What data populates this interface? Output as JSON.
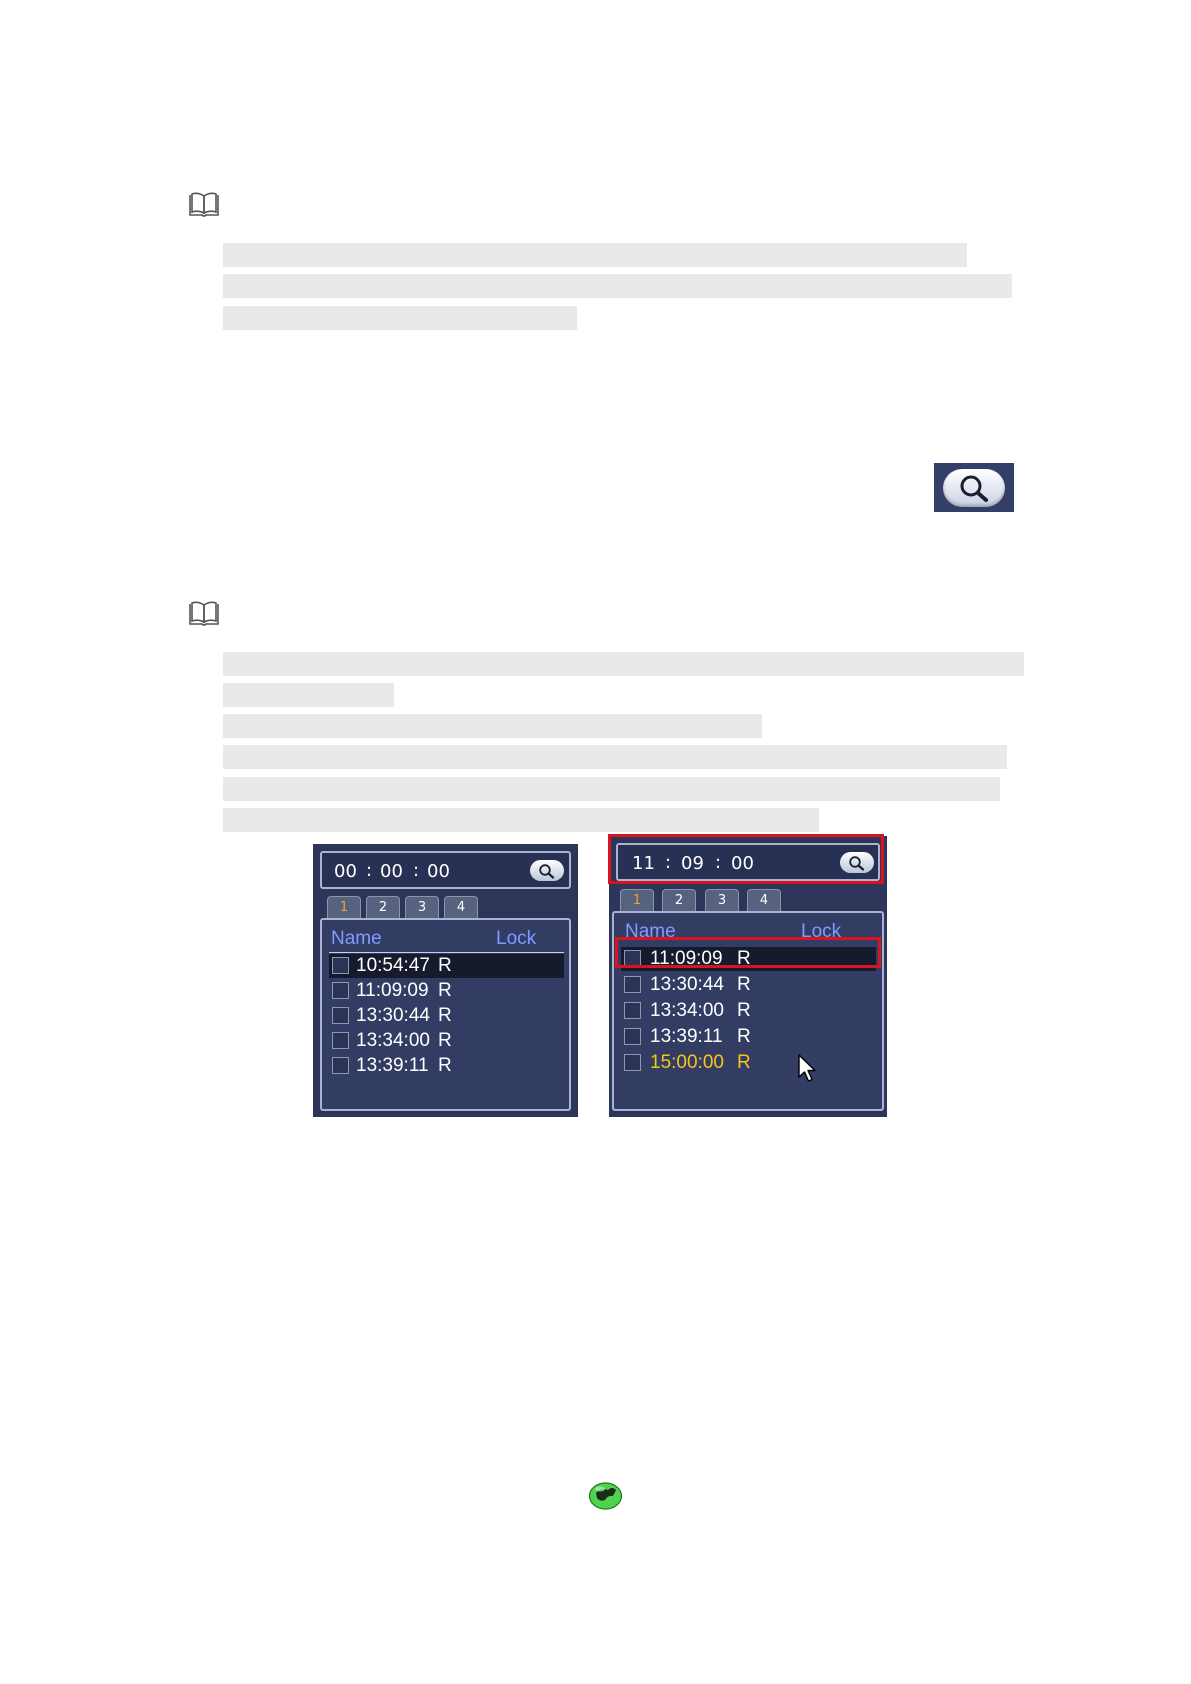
{
  "icons": {
    "note_icon": "book-icon",
    "search_icon": "magnifier-icon",
    "cursor_icon": "mouse-pointer-icon",
    "globe_icon": "green-globe-icon"
  },
  "panel_left": {
    "time": {
      "hh": "00",
      "sep1": ":",
      "mm": "00",
      "sep2": ":",
      "ss": "00"
    },
    "tabs": [
      {
        "label": "1"
      },
      {
        "label": "2"
      },
      {
        "label": "3"
      },
      {
        "label": "4"
      }
    ],
    "header": {
      "name": "Name",
      "lock": "Lock"
    },
    "rows": [
      {
        "time": "10:54:47",
        "type": "R"
      },
      {
        "time": "11:09:09",
        "type": "R"
      },
      {
        "time": "13:30:44",
        "type": "R"
      },
      {
        "time": "13:34:00",
        "type": "R"
      },
      {
        "time": "13:39:11",
        "type": "R"
      }
    ]
  },
  "panel_right": {
    "time": {
      "hh": "11",
      "sep1": ":",
      "mm": "09",
      "sep2": ":",
      "ss": "00"
    },
    "tabs": [
      {
        "label": "1"
      },
      {
        "label": "2"
      },
      {
        "label": "3"
      },
      {
        "label": "4"
      }
    ],
    "header": {
      "name": "Name",
      "lock": "Lock"
    },
    "rows": [
      {
        "time": "11:09:09",
        "type": "R"
      },
      {
        "time": "13:30:44",
        "type": "R"
      },
      {
        "time": "13:34:00",
        "type": "R"
      },
      {
        "time": "13:39:11",
        "type": "R"
      },
      {
        "time": "15:00:00",
        "type": "R"
      }
    ]
  },
  "colors": {
    "panel_bg": "#2d3658",
    "header_text": "#7f9bff",
    "highlight_text": "#f5c518",
    "annotation_red": "#d8141e",
    "active_tab_text": "#f1a133"
  }
}
